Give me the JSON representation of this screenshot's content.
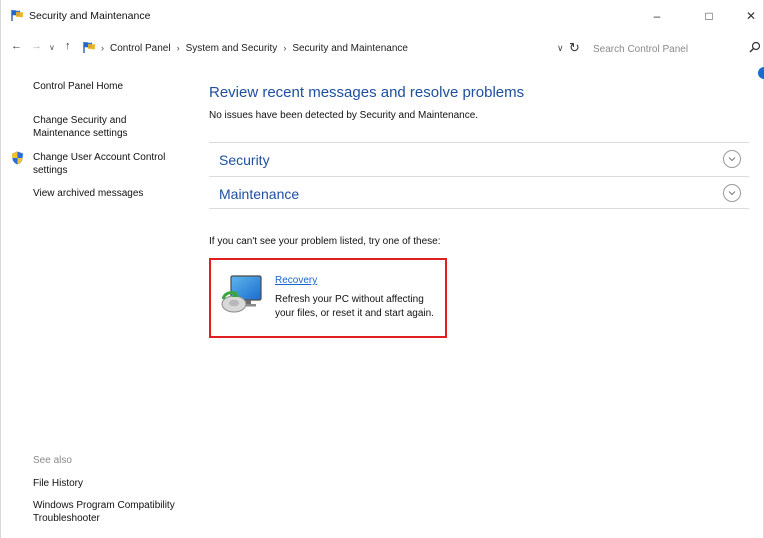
{
  "window": {
    "title": "Security and Maintenance",
    "minimize_glyph": "–",
    "maximize_glyph": "□",
    "close_glyph": "✕"
  },
  "address": {
    "back_glyph": "←",
    "forward_glyph": "→",
    "recent_glyph": "∨",
    "up_glyph": "↑",
    "breadcrumb": [
      "Control Panel",
      "System and Security",
      "Security and Maintenance"
    ],
    "separator": "›",
    "dropdown_glyph": "∨",
    "refresh_glyph": "↻",
    "search_placeholder": "Search Control Panel"
  },
  "sidebar": {
    "links": [
      "Control Panel Home",
      "Change Security and Maintenance settings",
      "Change User Account Control settings",
      "View archived messages"
    ],
    "see_also_label": "See also",
    "see_also_links": [
      "File History",
      "Windows Program Compatibility Troubleshooter"
    ]
  },
  "main": {
    "title": "Review recent messages and resolve problems",
    "status": "No issues have been detected by Security and Maintenance.",
    "sections": [
      "Security",
      "Maintenance"
    ],
    "hint": "If you can't see your problem listed, try one of these:",
    "recovery": {
      "link": "Recovery",
      "description": "Refresh your PC without affecting your files, or reset it and start again."
    }
  },
  "colors": {
    "link_blue": "#1e4fa0",
    "highlight_border": "#e02020",
    "accent_blue": "#1a6ccf"
  },
  "icons": [
    "security-maintenance-flag-icon",
    "uac-shield-icon",
    "search-icon",
    "chevron-down-icon",
    "recovery-icon"
  ]
}
